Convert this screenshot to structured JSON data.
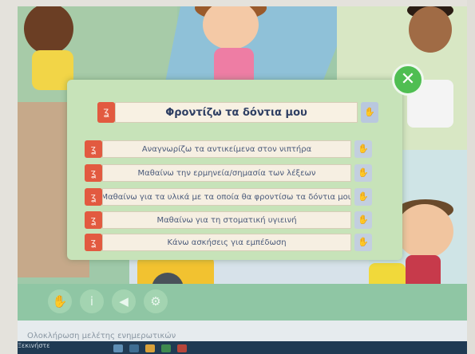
{
  "dialog": {
    "title": "Φροντίζω τα δόντια μου",
    "items": [
      {
        "label": "Αναγνωρίζω τα αντικείμενα στον νιπτήρα"
      },
      {
        "label": "Μαθαίνω την ερμηνεία/σημασία των λέξεων"
      },
      {
        "label": "Μαθαίνω για τα υλικά με τα οποία θα φροντίσω τα δόντια μου"
      },
      {
        "label": "Μαθαίνω για τη στοματική υγιεινή"
      },
      {
        "label": "Κάνω ασκήσεις για εμπέδωση"
      }
    ],
    "close_glyph": "✕"
  },
  "icons": {
    "ear_glyph": "ʓ",
    "hand_glyph": "✋"
  },
  "nav": {
    "buttons": [
      {
        "glyph": "✋"
      },
      {
        "glyph": "i"
      },
      {
        "glyph": "◀"
      },
      {
        "glyph": "⚙"
      }
    ]
  },
  "footer": {
    "text": "Ολοκλήρωση μελέτης ενημερωτικών",
    "taskbar_label": "Ξεκινήστε"
  },
  "colors": {
    "ear_red": "#e25a40",
    "hand_blue": "#c3cfdf",
    "close_green": "#4fbe52",
    "modal_bg": "#c7e3b9"
  }
}
